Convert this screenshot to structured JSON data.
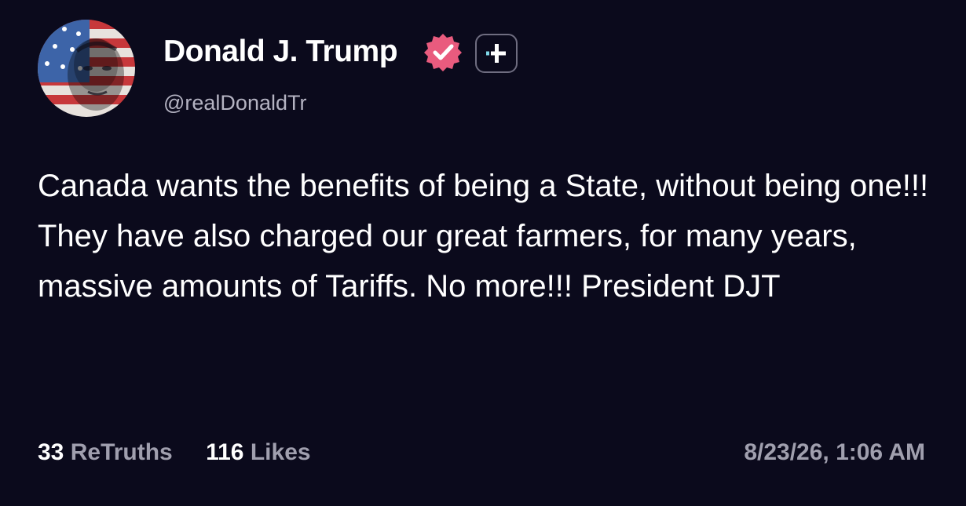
{
  "post": {
    "author": {
      "display_name": "Donald J. Trump",
      "handle": "@realDonaldTr",
      "avatar_icon": "avatar-flag-portrait",
      "verified_icon": "verified-badge-icon",
      "verified_color": "#e95b7e"
    },
    "follow_button_icon": "plus-icon",
    "text": "Canada wants the benefits of being a State, without being one!!! They have also charged our great farmers, for many years, massive amounts of Tariffs. No more!!! President DJT",
    "stats": {
      "retruths_count": "33",
      "retruths_label": "ReTruths",
      "likes_count": "116",
      "likes_label": "Likes"
    },
    "timestamp": "8/23/26, 1:06 AM"
  },
  "colors": {
    "background": "#0b0a1c",
    "text_primary": "#ffffff",
    "text_secondary": "#a09fae"
  }
}
